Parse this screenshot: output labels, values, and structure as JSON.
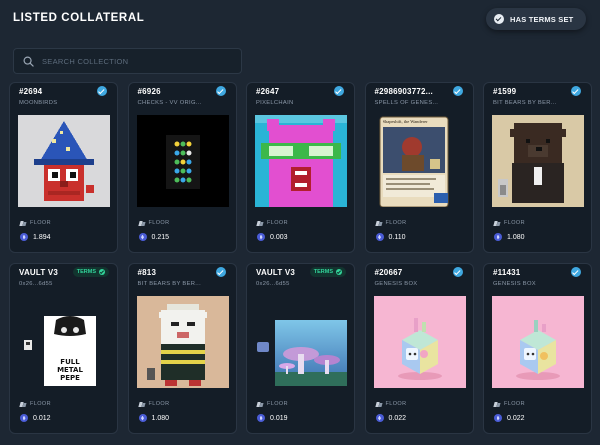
{
  "header": {
    "title": "LISTED COLLATERAL",
    "terms_button": "HAS TERMS SET"
  },
  "search": {
    "placeholder": "SEARCH COLLECTION",
    "value": ""
  },
  "floor_label": "FLOOR",
  "cards": [
    {
      "title": "#2694",
      "subtitle": "MOONBIRDS",
      "badge": "verified",
      "floor": "1.894"
    },
    {
      "title": "#6926",
      "subtitle": "CHECKS - VV ORIG...",
      "badge": "verified",
      "floor": "0.215"
    },
    {
      "title": "#2647",
      "subtitle": "PIXELCHAIN",
      "badge": "verified",
      "floor": "0.003"
    },
    {
      "title": "#2986903772...",
      "subtitle": "SPELLS OF GENES...",
      "badge": "verified",
      "floor": "0.110",
      "art_caption": "Shapeshift, the Wanderer"
    },
    {
      "title": "#1599",
      "subtitle": "BIT BEARS BY BER...",
      "badge": "verified",
      "floor": "1.080"
    },
    {
      "title": "VAULT V3",
      "subtitle": "0x26...6d55",
      "badge": "terms",
      "terms_label": "TERMS",
      "floor": "0.012",
      "art_caption": "FULL METAL PEPE"
    },
    {
      "title": "#813",
      "subtitle": "BIT BEARS BY BER...",
      "badge": "verified",
      "floor": "1.080"
    },
    {
      "title": "VAULT V3",
      "subtitle": "0x26...6d55",
      "badge": "terms",
      "terms_label": "TERMS",
      "floor": "0.019"
    },
    {
      "title": "#20667",
      "subtitle": "GENESIS BOX",
      "badge": "verified",
      "floor": "0.022"
    },
    {
      "title": "#11431",
      "subtitle": "GENESIS BOX",
      "badge": "verified",
      "floor": "0.022"
    }
  ],
  "colors": {
    "background": "#1d2733",
    "card": "#141d27",
    "verified": "#3fa8e0",
    "terms": "#32d39a",
    "eth": "#4a5cd6"
  }
}
